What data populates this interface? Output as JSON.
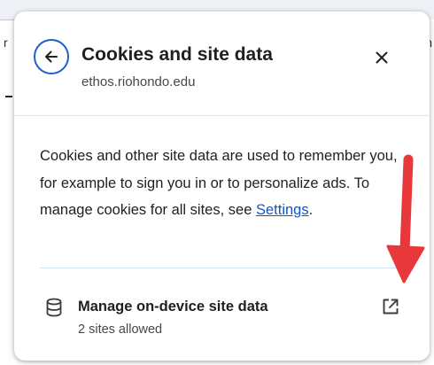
{
  "dialog": {
    "title": "Cookies and site data",
    "site": "ethos.riohondo.edu",
    "back_icon": "arrow-left-icon",
    "close_icon": "close-icon"
  },
  "description": {
    "text": "Cookies and other site data are used to remember you, for example to sign you in or to personalize ads. To manage cookies for all sites, see ",
    "link_label": "Settings",
    "suffix": "."
  },
  "manage": {
    "label": "Manage on-device site data",
    "sublabel": "2 sites allowed",
    "icon": "database-icon",
    "action_icon": "open-in-new-icon"
  },
  "background": {
    "left_char": "r",
    "right_char": "n"
  },
  "colors": {
    "accent": "#0b57d0",
    "annotation": "#e8383b"
  }
}
